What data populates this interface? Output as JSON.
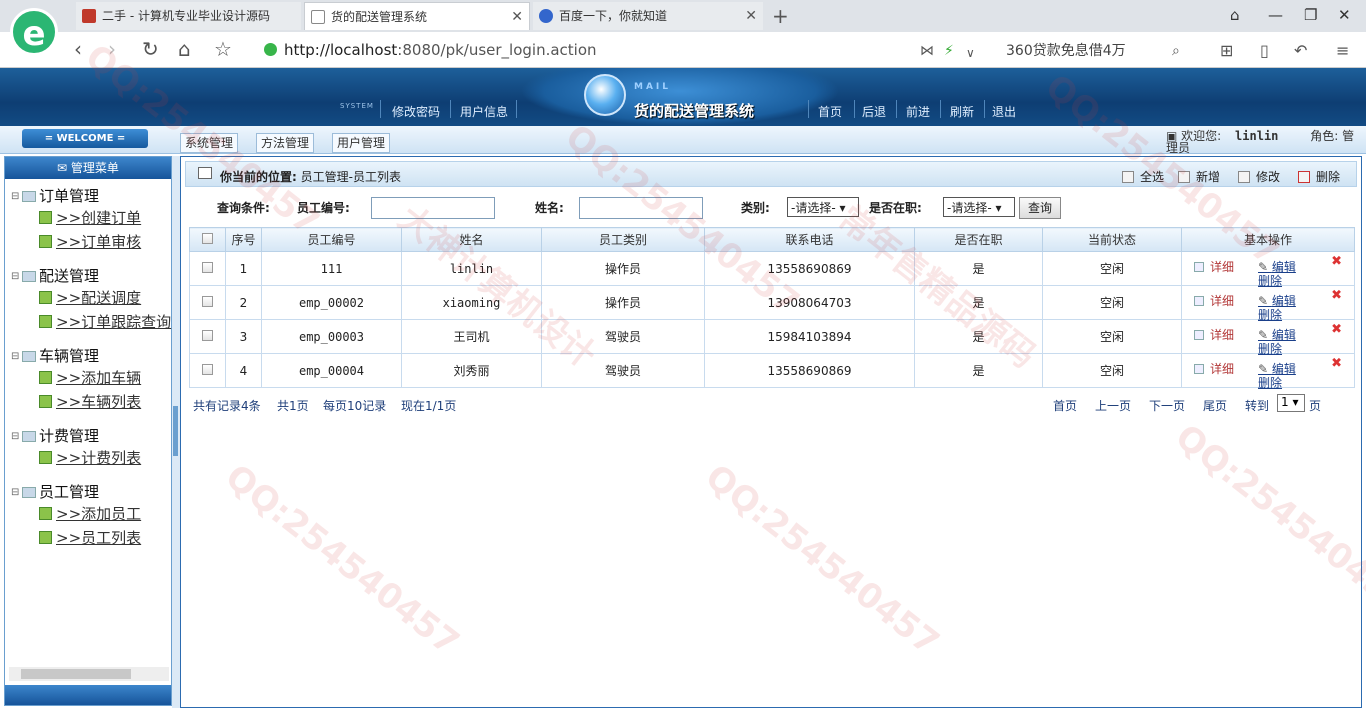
{
  "browser": {
    "tabs": [
      {
        "title": "二手 - 计算机专业毕业设计源码"
      },
      {
        "title": "货的配送管理系统"
      },
      {
        "title": "百度一下，你就知道"
      }
    ],
    "url_host": "http://localhost",
    "url_rest": ":8080/pk/user_login.action",
    "promo": "360贷款免息借4万"
  },
  "header": {
    "system_label": "SYSTEM",
    "left_links": [
      "修改密码",
      "用户信息"
    ],
    "mail_label": "MAIL",
    "app_title": "货的配送管理系统",
    "right_links": [
      "首页",
      "后退",
      "前进",
      "刷新",
      "退出"
    ]
  },
  "strip": {
    "welcome": "= WELCOME =",
    "tabs": [
      "系统管理",
      "方法管理",
      "用户管理"
    ],
    "welcome_user_label": "欢迎您:",
    "username": "linlin",
    "role_label": "角色:",
    "role_value": "管理员"
  },
  "sidebar": {
    "title": "管理菜单",
    "groups": [
      {
        "label": "订单管理",
        "items": [
          ">>创建订单",
          ">>订单审核"
        ]
      },
      {
        "label": "配送管理",
        "items": [
          ">>配送调度",
          ">>订单跟踪查询"
        ]
      },
      {
        "label": "车辆管理",
        "items": [
          ">>添加车辆",
          ">>车辆列表"
        ]
      },
      {
        "label": "计费管理",
        "items": [
          ">>计费列表"
        ]
      },
      {
        "label": "员工管理",
        "items": [
          ">>添加员工",
          ">>员工列表"
        ]
      }
    ]
  },
  "main": {
    "location_label": "你当前的位置:",
    "location_path": "员工管理-员工列表",
    "toolbar": {
      "select_all": "全选",
      "add": "新增",
      "edit": "修改",
      "delete": "删除"
    },
    "query": {
      "label": "查询条件:",
      "emp_no_label": "员工编号:",
      "name_label": "姓名:",
      "type_label": "类别:",
      "type_value": "-请选择-",
      "onjob_label": "是否在职:",
      "onjob_value": "-请选择-",
      "submit": "查询"
    },
    "table": {
      "columns": [
        "序号",
        "员工编号",
        "姓名",
        "员工类别",
        "联系电话",
        "是否在职",
        "当前状态",
        "基本操作"
      ],
      "rows": [
        {
          "no": "1",
          "emp_no": "111",
          "name": "linlin",
          "type": "操作员",
          "phone": "13558690869",
          "onjob": "是",
          "status": "空闲"
        },
        {
          "no": "2",
          "emp_no": "emp_00002",
          "name": "xiaoming",
          "type": "操作员",
          "phone": "13908064703",
          "onjob": "是",
          "status": "空闲"
        },
        {
          "no": "3",
          "emp_no": "emp_00003",
          "name": "王司机",
          "type": "驾驶员",
          "phone": "15984103894",
          "onjob": "是",
          "status": "空闲"
        },
        {
          "no": "4",
          "emp_no": "emp_00004",
          "name": "刘秀丽",
          "type": "驾驶员",
          "phone": "13558690869",
          "onjob": "是",
          "status": "空闲"
        }
      ],
      "ops": {
        "detail": "详细",
        "edit": "编辑",
        "delete": "删除"
      }
    },
    "pager": {
      "total": "共有记录4条",
      "pages": "共1页",
      "per_page": "每页10记录",
      "current": "现在1/1页",
      "first": "首页",
      "prev": "上一页",
      "next": "下一页",
      "last": "尾页",
      "goto_label": "转到",
      "goto_value": "1",
      "page_unit": "页"
    }
  },
  "watermarks": [
    "QQ:254540457",
    "大神计算机设计",
    "常年售精品源码"
  ]
}
